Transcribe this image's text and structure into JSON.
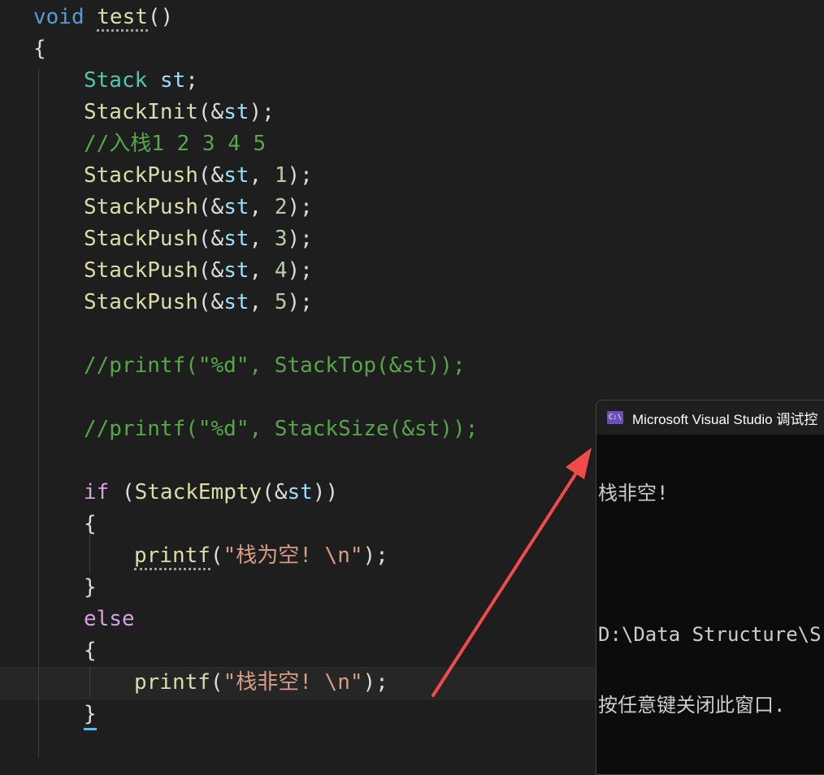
{
  "code": {
    "l1": {
      "kw": "void",
      "fn": "test",
      "punct": "()"
    },
    "l2": "{",
    "l3": {
      "type": "Stack",
      "var": "st",
      "end": ";"
    },
    "l4": {
      "fn": "StackInit",
      "open": "(&",
      "var": "st",
      "close": ");"
    },
    "l5": "//入栈1 2 3 4 5",
    "push": {
      "fn": "StackPush",
      "open": "(&",
      "var": "st",
      "sep": ", ",
      "close": ");"
    },
    "push_values": [
      "1",
      "2",
      "3",
      "4",
      "5"
    ],
    "l11": "//printf(\"%d\", StackTop(&st));",
    "l13": "//printf(\"%d\", StackSize(&st));",
    "l15": {
      "kw": "if",
      "mid": " (",
      "fn": "StackEmpty",
      "open": "(&",
      "var": "st",
      "close": "))"
    },
    "l16": "{",
    "l17": {
      "fn": "printf",
      "open": "(",
      "str": "\"栈为空! \\n\"",
      "close": ");"
    },
    "l18": "}",
    "l19": "else",
    "l20": "{",
    "l21": {
      "fn": "printf",
      "open": "(",
      "str": "\"栈非空! \\n\"",
      "close": ");"
    },
    "l22": "}"
  },
  "console": {
    "title": "Microsoft Visual Studio 调试控",
    "output_line": "栈非空!",
    "path_line": "D:\\Data Structure\\S",
    "close_hint": "按任意键关闭此窗口."
  },
  "icons": {
    "console": "cmd-window-icon",
    "arrow": "red-annotation-arrow"
  },
  "colors": {
    "background": "#1e1e1e",
    "keyword": "#569cd6",
    "control_keyword": "#d8a0df",
    "type": "#4ec9b0",
    "function": "#dcdcaa",
    "variable": "#9cdcfe",
    "number": "#b5cea8",
    "string": "#d69d85",
    "comment": "#57a64a",
    "arrow": "#f04a4a"
  }
}
